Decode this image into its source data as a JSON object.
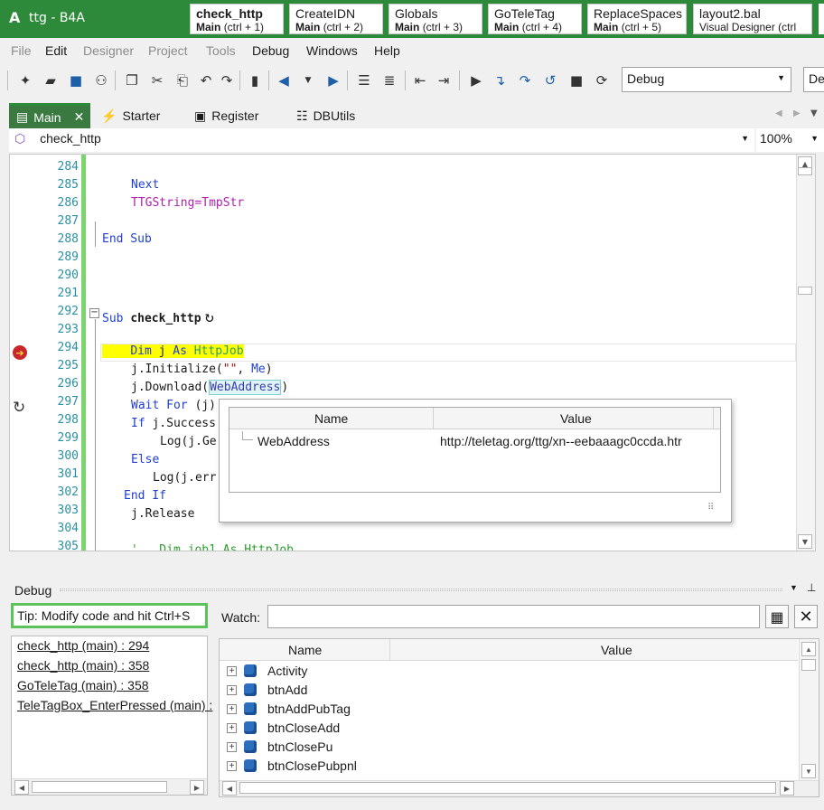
{
  "window": {
    "app_letter": "A",
    "title": "ttg - B4A"
  },
  "quick_tabs": [
    {
      "title": "check_http",
      "module": "Main",
      "shortcut": "(ctrl + 1)"
    },
    {
      "title": "CreateIDN",
      "module": "Main",
      "shortcut": "(ctrl + 2)"
    },
    {
      "title": "Globals",
      "module": "Main",
      "shortcut": "(ctrl + 3)"
    },
    {
      "title": "GoTeleTag",
      "module": "Main",
      "shortcut": "(ctrl + 4)"
    },
    {
      "title": "ReplaceSpaces",
      "module": "Main",
      "shortcut": "(ctrl + 5)"
    },
    {
      "title": "layout2.bal",
      "module": "Visual Designer",
      "shortcut": "(ctrl"
    }
  ],
  "menu": [
    "File",
    "Edit",
    "Designer",
    "Project",
    "Tools",
    "Debug",
    "Windows",
    "Help"
  ],
  "toolbar": {
    "config_combo": "Debug",
    "device_combo": "Def"
  },
  "editor_tabs": [
    {
      "label": "Main",
      "close": "✕"
    },
    {
      "label": "Starter"
    },
    {
      "label": "Register"
    },
    {
      "label": "DBUtils"
    }
  ],
  "sub_combo": {
    "value": "check_http"
  },
  "zoom_combo": {
    "value": "100%"
  },
  "code_lines": [
    {
      "n": "284"
    },
    {
      "n": "285"
    },
    {
      "n": "286"
    },
    {
      "n": "287"
    },
    {
      "n": "288"
    },
    {
      "n": "289"
    },
    {
      "n": "290"
    },
    {
      "n": "291"
    },
    {
      "n": "292"
    },
    {
      "n": "293"
    },
    {
      "n": "294"
    },
    {
      "n": "295"
    },
    {
      "n": "296"
    },
    {
      "n": "297"
    },
    {
      "n": "298"
    },
    {
      "n": "299"
    },
    {
      "n": "300"
    },
    {
      "n": "301"
    },
    {
      "n": "302"
    },
    {
      "n": "303"
    },
    {
      "n": "304"
    },
    {
      "n": "305"
    }
  ],
  "code": {
    "l285": "Next",
    "l286": "TTGString=TmpStr",
    "l288_kw": "End Sub",
    "l292_kw": "Sub",
    "l292_name": "check_http",
    "l294_kw1": "Dim",
    "l294_var": " j ",
    "l294_kw2": "As",
    "l294_type": "HttpJob",
    "l295_a": "j.Initialize(",
    "l295_str": "\"\"",
    "l295_b": ", ",
    "l295_me": "Me",
    "l295_c": ")",
    "l296_a": "j.Download(",
    "l296_var": "WebAddress",
    "l296_c": ")",
    "l297_kw": "Wait For",
    "l297_rest": " (j)",
    "l298_kw": "If",
    "l298_rest": " j.Success",
    "l299": "Log(j.Ge",
    "l300_kw": "Else",
    "l301": "Log(j.err",
    "l302_kw": "End If",
    "l303": "j.Release",
    "l305": "'   Dim job1 As HttpJob"
  },
  "popup": {
    "col_name": "Name",
    "col_value": "Value",
    "rows": [
      {
        "name": "WebAddress",
        "value": "http://teletag.org/ttg/xn--eebaaagc0ccda.htr"
      }
    ]
  },
  "debug": {
    "title": "Debug",
    "tip": "Tip: Modify code and hit Ctrl+S",
    "watch_label": "Watch:",
    "watch_value": "",
    "call_stack": [
      "check_http (main) : 294",
      "check_http (main) : 358",
      "GoTeleTag (main) : 358",
      "TeleTagBox_EnterPressed (main) :"
    ],
    "vars_col_name": "Name",
    "vars_col_value": "Value",
    "vars": [
      "Activity",
      "btnAdd",
      "btnAddPubTag",
      "btnCloseAdd",
      "btnClosePu",
      "btnClosePubpnl"
    ]
  }
}
